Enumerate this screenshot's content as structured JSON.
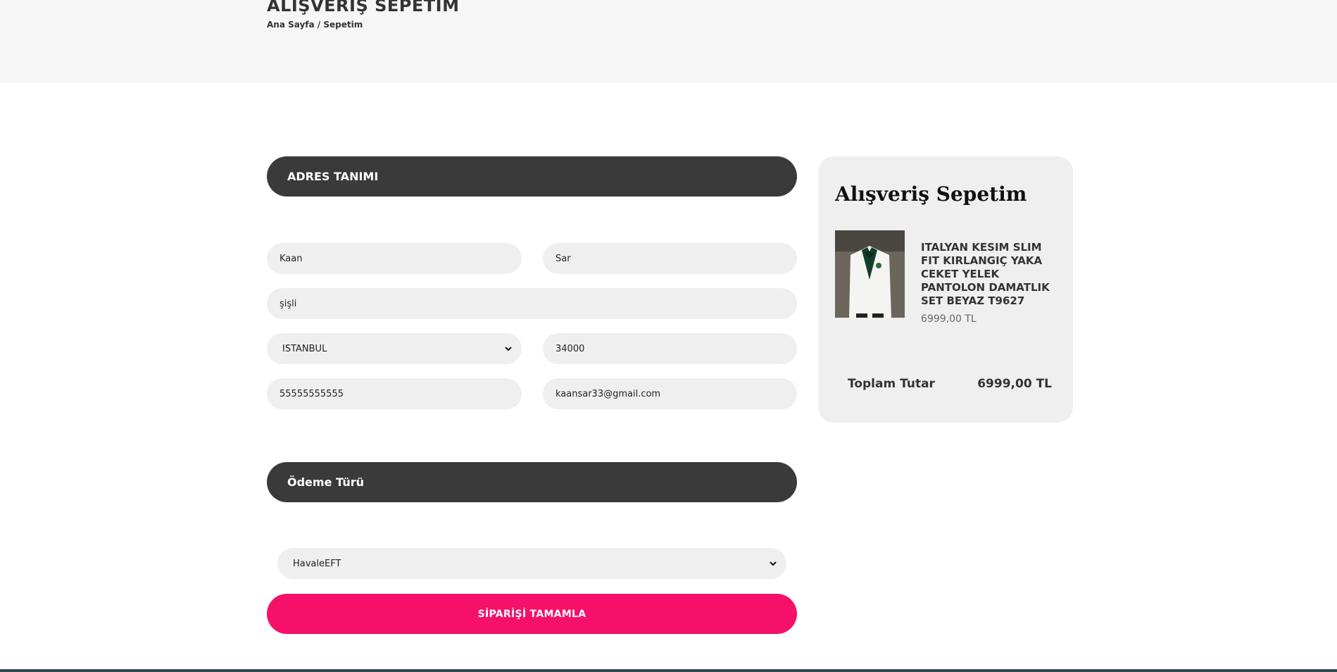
{
  "header": {
    "title": "ALIŞVERİŞ SEPETİM",
    "breadcrumb_home": "Ana Sayfa",
    "breadcrumb_sep": " / ",
    "breadcrumb_current": "Sepetim"
  },
  "address_section": {
    "title": "ADRES TANIMI",
    "first_name": "Kaan",
    "last_name": "Sar",
    "address": "şişli",
    "city": "ISTANBUL",
    "zip": "34000",
    "phone": "55555555555",
    "email": "kaansar33@gmail.com"
  },
  "payment_section": {
    "title": "Ödeme Türü",
    "method": "HavaleEFT"
  },
  "submit_label": "SİPARİŞİ TAMAMLA",
  "cart": {
    "title": "Alışveriş Sepetim",
    "items": [
      {
        "name": "ITALYAN KESIM SLIM FIT KIRLANGIÇ YAKA CEKET YELEK PANTOLON DAMATLIK SET BEYAZ T9627",
        "price": "6999,00 TL"
      }
    ],
    "total_label": "Toplam Tutar",
    "total_value": "6999,00 TL"
  },
  "colors": {
    "dark_bar": "#3a3a3a",
    "accent": "#f5106a",
    "field_bg": "#efefef",
    "header_bg": "#f6f6f6"
  }
}
